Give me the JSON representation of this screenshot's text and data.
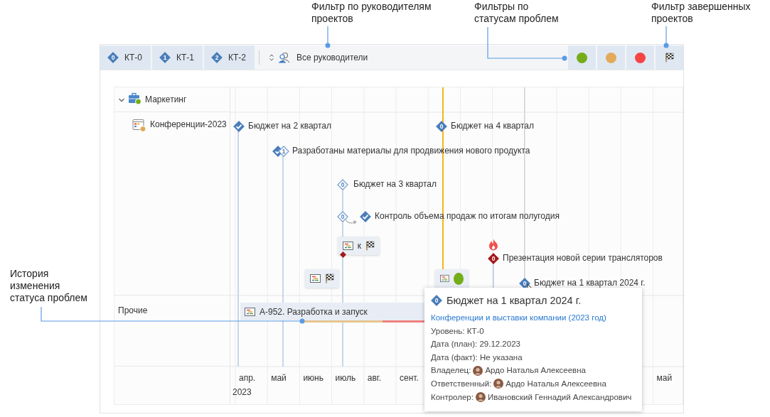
{
  "annotations": [
    {
      "text": "Фильтр по руководителям проектов"
    },
    {
      "text": "Фильтры по статусам проблем"
    },
    {
      "text": "Фильтр завершенных проектов"
    },
    {
      "text": "История изменения статуса проблем"
    }
  ],
  "toolbar": {
    "levels": [
      {
        "badge": "0",
        "label": "КТ-0",
        "selected": true
      },
      {
        "badge": "1",
        "label": "КТ-1",
        "selected": true
      },
      {
        "badge": "2",
        "label": "КТ-2",
        "selected": true
      }
    ],
    "manager_filter": "Все руководители",
    "status_filters": [
      {
        "color": "#74ad1a",
        "selected": true
      },
      {
        "color": "#e2aa5a",
        "selected": true
      },
      {
        "color": "#f74444",
        "selected": true
      }
    ],
    "completed_filter": {
      "selected": true
    }
  },
  "tree": [
    {
      "label": "Маркетинг",
      "expanded": true,
      "children": [
        {
          "label": "Конференции-2023"
        }
      ]
    },
    {
      "label": "Прочие"
    }
  ],
  "milestones": [
    {
      "label": "Бюджет на 2 квартал",
      "markers": [
        {
          "kind": "done"
        }
      ]
    },
    {
      "label": "Бюджет на 4 квартал",
      "markers": [
        {
          "kind": "level",
          "badge": "0"
        }
      ]
    },
    {
      "label": "Разработаны материалы для продвижения нового продукта",
      "markers": [
        {
          "kind": "done"
        },
        {
          "kind": "plan",
          "badge": "1"
        }
      ]
    },
    {
      "label": "Бюджет на 3 квартал",
      "markers": [
        {
          "kind": "plan",
          "badge": "0"
        }
      ]
    },
    {
      "label": "Контроль объема продаж по итогам полугодия",
      "markers": [
        {
          "kind": "plan",
          "badge": "0"
        },
        {
          "kind": "done"
        }
      ]
    },
    {
      "label": "Презентация новой серии трансляторов",
      "markers": [
        {
          "kind": "overdue",
          "badge": "0"
        }
      ]
    },
    {
      "label": "Бюджет на 1 квартал 2024 г.",
      "markers": [
        {
          "kind": "level",
          "badge": "0"
        }
      ]
    }
  ],
  "issue_chips": [
    {
      "label": "к",
      "kind": "flag",
      "overdue": true
    },
    {
      "kind": "flag",
      "overdue": false
    },
    {
      "kind": "dot",
      "color": "#74ad1a",
      "overdue": false
    }
  ],
  "bars": [
    {
      "label": "А-952. Разработка и запуск"
    }
  ],
  "axis": {
    "months": [
      "апр.",
      "май",
      "июнь",
      "июль",
      "авг.",
      "сент."
    ],
    "months_right": [
      "май"
    ],
    "year": "2023"
  },
  "tooltip": {
    "badge": "0",
    "title": "Бюджет на 1 квартал 2024 г.",
    "link": "Конференции и выставки компании (2023 год)",
    "lines": [
      "Уровень: КТ-0",
      "Дата (план): 29.12.2023",
      "Дата (факт): Не указана"
    ],
    "people": [
      {
        "role": "Владелец:",
        "name": "Ардо Наталья Алексеевна"
      },
      {
        "role": "Ответственный:",
        "name": "Ардо Наталья Алексеевна"
      },
      {
        "role": "Контролер:",
        "name": "Ивановский Геннадий Александрович"
      }
    ]
  }
}
